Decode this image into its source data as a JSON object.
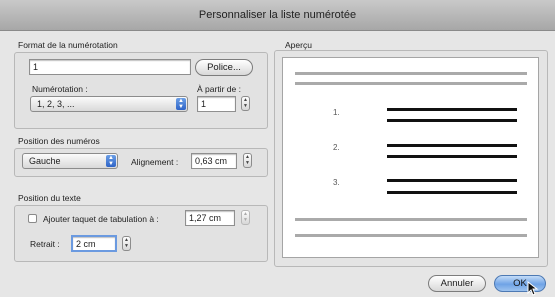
{
  "window": {
    "title": "Personnaliser la liste numérotée"
  },
  "format": {
    "section_label": "Format de la numérotation",
    "format_value": "1",
    "police_button": "Police...",
    "numerotation_label": "Numérotation :",
    "numerotation_value": "1, 2, 3, ...",
    "start_label": "À partir de :",
    "start_value": "1"
  },
  "position_numeros": {
    "section_label": "Position des numéros",
    "align_value": "Gauche",
    "alignement_label": "Alignement :",
    "alignement_value": "0,63 cm"
  },
  "position_texte": {
    "section_label": "Position du texte",
    "tab_checkbox_label": "Ajouter taquet de tabulation à :",
    "tab_checked": false,
    "tab_value": "1,27 cm",
    "retrait_label": "Retrait :",
    "retrait_value": "2 cm"
  },
  "preview": {
    "label": "Aperçu",
    "numbers": [
      "1.",
      "2.",
      "3."
    ]
  },
  "buttons": {
    "cancel": "Annuler",
    "ok": "OK"
  }
}
